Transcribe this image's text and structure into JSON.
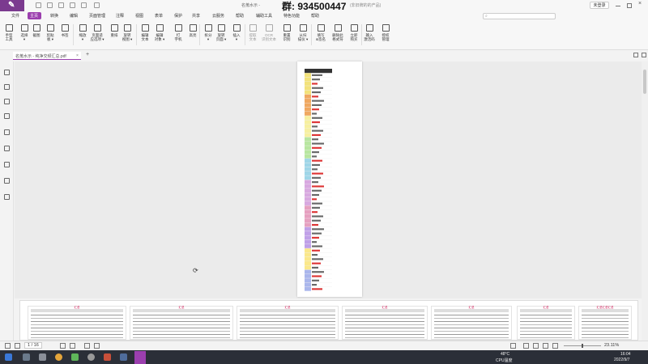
{
  "window": {
    "title": "名蒐水示 -",
    "overlay_text": "群: 934500447",
    "title_suffix": "(非旧牌的的产品)",
    "login_label": "未登录"
  },
  "menu": {
    "items": [
      "文件",
      "主页",
      "转换",
      "编辑",
      "页面管理",
      "注释",
      "视图",
      "表单",
      "保护",
      "共享",
      "云服务",
      "帮助",
      "辅助工具",
      "特色功能",
      "帮助"
    ],
    "active_index": 1
  },
  "search": {
    "placeholder": ""
  },
  "ribbon": {
    "tools": [
      {
        "label": "手型\n工具",
        "icon": "hand-icon"
      },
      {
        "label": "选择\n▾",
        "icon": "select-icon"
      },
      {
        "label": "截图",
        "icon": "screenshot-icon"
      },
      {
        "label": "剪贴\n板 ▾",
        "icon": "clipboard-icon"
      },
      {
        "label": "书签",
        "icon": "bookmark-icon"
      },
      {
        "label": "缩放\n▾",
        "icon": "zoom-icon"
      },
      {
        "label": "页面适\n应选项 ▾",
        "icon": "fit-page-icon"
      },
      {
        "label": "重排",
        "icon": "reflow-icon"
      },
      {
        "label": "旋转\n视图 ▾",
        "icon": "rotate-icon"
      },
      {
        "label": "编辑\n文本",
        "icon": "edit-text-icon"
      },
      {
        "label": "编辑\n对象 ▾",
        "icon": "edit-object-icon"
      },
      {
        "label": "打\n字机",
        "icon": "typewriter-icon"
      },
      {
        "label": "高亮",
        "icon": "highlight-icon"
      },
      {
        "label": "拆分\n▾",
        "icon": "split-icon"
      },
      {
        "label": "旋转\n页面 ▾",
        "icon": "rotate-page-icon"
      },
      {
        "label": "插入\n▾",
        "icon": "insert-icon"
      },
      {
        "label": "提取\n文本",
        "icon": "extract-text-icon"
      },
      {
        "label": "OCR\n识别文本",
        "icon": "ocr-icon"
      },
      {
        "label": "重置\n识别",
        "icon": "reset-icon"
      },
      {
        "label": "从扫\n描仪 ▾",
        "icon": "scanner-icon"
      },
      {
        "label": "填写\n&签名",
        "icon": "sign-icon"
      },
      {
        "label": "删除此\n格式符",
        "icon": "delete-format-icon"
      },
      {
        "label": "立即\n购买",
        "icon": "buy-icon"
      },
      {
        "label": "输入\n激活码",
        "icon": "activate-icon"
      },
      {
        "label": "授权\n管理",
        "icon": "license-icon"
      }
    ]
  },
  "tab": {
    "label": "名蒐水示 - 纯净交频汇总.pdf",
    "close": "×",
    "add": "+"
  },
  "document": {
    "rows": 52
  },
  "thumbnails": [
    {
      "caption": "汇总"
    },
    {
      "caption": "汇总"
    },
    {
      "caption": "汇总"
    },
    {
      "caption": "汇总"
    },
    {
      "caption": "汇总"
    },
    {
      "caption": "汇总"
    },
    {
      "caption": "汇总汇总汇总"
    }
  ],
  "status": {
    "page_current": "1 / 16",
    "zoom": "23.11%",
    "cpu_temp": "48°C",
    "cpu_label": "CPU温度",
    "time": "16:04",
    "date": "2022/9/7"
  }
}
